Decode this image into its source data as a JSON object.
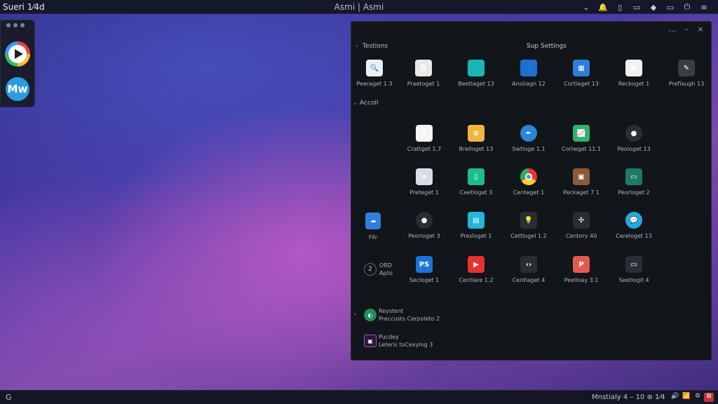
{
  "topbar": {
    "left_title": "Sueri 1⁄4d",
    "center_title": "Asmi | Asmi",
    "tray_icons": [
      "chevron-down-icon",
      "bell-icon",
      "clipboard-icon",
      "monitor-icon",
      "network-icon",
      "battery-icon",
      "power-icon",
      "settings-icon"
    ],
    "tray_glyphs": [
      "⌄",
      "🔔",
      "▯",
      "▭",
      "◆",
      "▭",
      "⏻",
      "≡"
    ]
  },
  "dock": {
    "apps": [
      {
        "name": "media-player",
        "label": ""
      },
      {
        "name": "mw-app",
        "label": "Mw"
      }
    ]
  },
  "window": {
    "title": "Sup Settings",
    "controls": [
      "…",
      "–",
      "×"
    ],
    "sections": [
      {
        "name": "Testions"
      },
      {
        "name": "Accoil"
      }
    ],
    "row1": [
      {
        "label": "Peeraget 1.3",
        "icon": "search-icon",
        "color": "#e9f0fb",
        "glyph": "🔍"
      },
      {
        "label": "Praetoget 1",
        "icon": "camera-icon",
        "color": "#e8e8e8",
        "glyph": "◘"
      },
      {
        "label": "Beetlaget 13",
        "icon": "chat-icon",
        "color": "#19b6b8",
        "glyph": ""
      },
      {
        "label": "Anoliagn 12",
        "icon": "user-icon",
        "color": "#1f6fd1",
        "glyph": "👤"
      },
      {
        "label": "Cortlaget 13",
        "icon": "window-icon",
        "color": "#2c7fd8",
        "glyph": "▦"
      },
      {
        "label": "Reckoget 1",
        "icon": "calendar-icon",
        "color": "#f1f1f1",
        "glyph": "▦"
      },
      {
        "label": "Preflaugh 13",
        "icon": "document-icon",
        "color": "#3b3e44",
        "glyph": "✎"
      }
    ],
    "grid": [
      [
        {
          "label": "Crattget 1.7",
          "icon": "photos-icon",
          "color": "#f5f5f5",
          "glyph": "✿"
        },
        {
          "label": "Brelloget 13",
          "icon": "notes-icon",
          "color": "#f2b542",
          "glyph": "≡"
        },
        {
          "label": "Swtloge 1.1",
          "icon": "feather-icon",
          "color": "#2a86d9",
          "glyph": "✒"
        },
        {
          "label": "Corlwget 11.1",
          "icon": "chart-icon",
          "color": "#2fb36a",
          "glyph": "📈"
        },
        {
          "label": "Peologet 13",
          "icon": "palette-icon",
          "color": "#2a2e35",
          "glyph": "●"
        }
      ],
      [
        {
          "label": "Preteget 1",
          "icon": "glasses-icon",
          "color": "#d9dde3",
          "glyph": "∞"
        },
        {
          "label": "Ceetlogat 3",
          "icon": "tablet-icon",
          "color": "#1bbf8a",
          "glyph": "▯"
        },
        {
          "label": "Centeget 1",
          "icon": "chrome-icon",
          "color": "#ffffff",
          "glyph": ""
        },
        {
          "label": "Peckaget 7 1",
          "icon": "bag-icon",
          "color": "#8a5a3a",
          "glyph": "▣"
        },
        {
          "label": "Peorloget 2",
          "icon": "terminal-icon",
          "color": "#1f7a63",
          "glyph": "▭"
        }
      ],
      [
        {
          "label": "Peorloget 3",
          "icon": "disc-icon",
          "color": "#2a2d33",
          "glyph": "●"
        },
        {
          "label": "Presloget 1",
          "icon": "file-icon",
          "color": "#22b7d6",
          "glyph": "▤"
        },
        {
          "label": "Cettlogel 1.2",
          "icon": "bulb-icon",
          "color": "#2a2d33",
          "glyph": "💡"
        },
        {
          "label": "Centory 40",
          "icon": "slack-icon",
          "color": "#2a2d33",
          "glyph": "✣"
        },
        {
          "label": "Cereloget 13",
          "icon": "bubble-icon",
          "color": "#23a9e1",
          "glyph": "💬"
        }
      ],
      [
        {
          "label": "Secloget 1",
          "icon": "ps-icon",
          "color": "#1c73d8",
          "glyph": "PS"
        },
        {
          "label": "Centlare 1.2",
          "icon": "youtube-icon",
          "color": "#e3342f",
          "glyph": "▶"
        },
        {
          "label": "Centlaget 4",
          "icon": "code-icon",
          "color": "#2a2d33",
          "glyph": "‹›"
        },
        {
          "label": "Peelloay 3.1",
          "icon": "pdf-icon",
          "color": "#e35b4f",
          "glyph": "P"
        },
        {
          "label": "Seetlogit 4",
          "icon": "message-icon",
          "color": "#2a2d33",
          "glyph": "▭"
        }
      ]
    ],
    "side_items": [
      {
        "label": "Fllr",
        "icon": "cloud-drive-icon",
        "color": "#2f7fe0",
        "glyph": "☁"
      },
      {
        "label_line1": "ORD",
        "label_line2": "Apils",
        "icon": "number-2-icon",
        "glyph": "2"
      }
    ],
    "list_items": [
      {
        "line1": "Reystent",
        "line2": "Preccusts Cerpoleto 2",
        "icon": "green-circle-icon",
        "color": "#1d8f5a"
      },
      {
        "line1": "Pucdey",
        "line2": "Leteris toCevylog 3",
        "icon": "purple-box-icon",
        "color": "#6b2a8f"
      }
    ]
  },
  "bottombar": {
    "start_glyph": "G",
    "status_text": "Mnstialy 4 – 10 ⊕ 1⁄4",
    "tray": [
      "🔊",
      "📶",
      "⚙",
      "⊞"
    ]
  }
}
